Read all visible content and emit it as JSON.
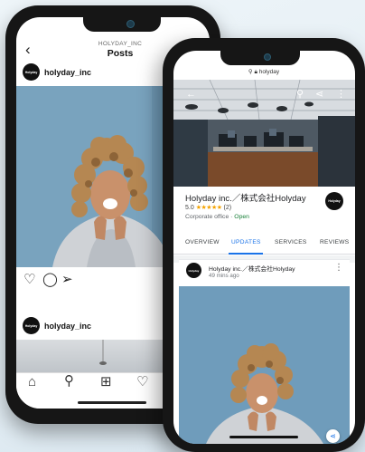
{
  "instagram": {
    "header": {
      "subtitle": "HOLYDAY_INC",
      "title": "Posts"
    },
    "post1": {
      "username": "holyday_inc",
      "avatar_text": "Holyday"
    },
    "post2": {
      "username": "holyday_inc",
      "avatar_text": "Holyday"
    },
    "actions": [
      "like-icon",
      "comment-icon",
      "share-icon"
    ],
    "bottom_nav": [
      "home-icon",
      "search-icon",
      "add-icon",
      "activity-icon"
    ]
  },
  "google": {
    "url": "holyday",
    "business": {
      "name": "Holyday inc.／株式会社Holyday",
      "rating": "5.0",
      "stars": "★★★★★",
      "review_count": "(2)",
      "category": "Corporate office",
      "separator": "·",
      "status": "Open",
      "logo_text": "Holyday"
    },
    "tabs": [
      {
        "label": "OVERVIEW",
        "active": false
      },
      {
        "label": "UPDATES",
        "active": true
      },
      {
        "label": "SERVICES",
        "active": false
      },
      {
        "label": "REVIEWS",
        "active": false
      }
    ],
    "post": {
      "name": "Holyday inc.／株式会社Holyday",
      "time": "49 mins ago",
      "avatar_text": "Holyday"
    },
    "colors": {
      "accent": "#1a73e8",
      "open": "#188038",
      "stars": "#f4a300"
    }
  }
}
